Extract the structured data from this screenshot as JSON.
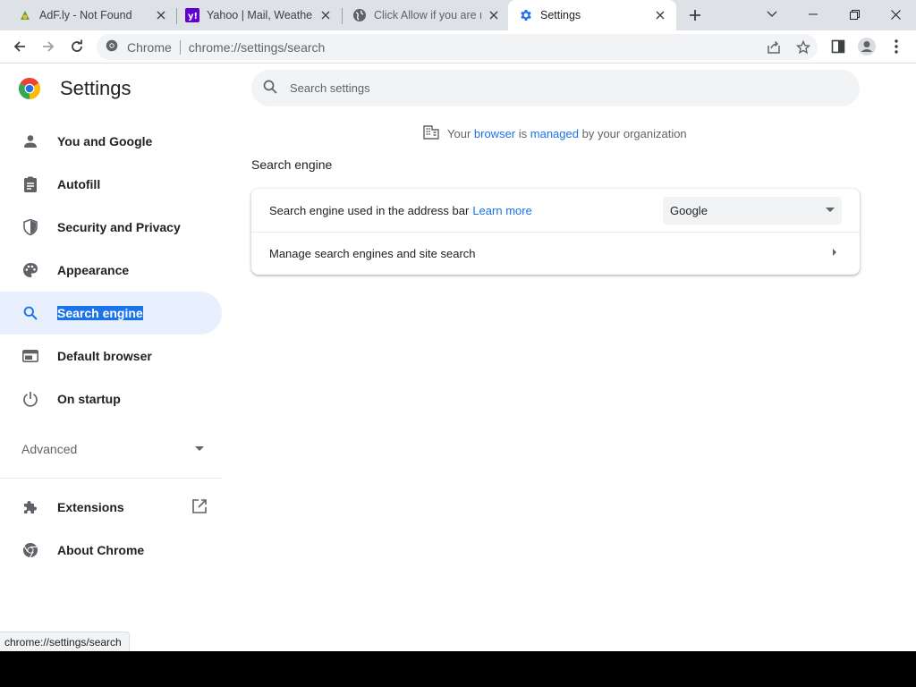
{
  "tabs": [
    {
      "title": "AdF.ly - Not Found",
      "favicon": "adfly-favicon",
      "active": false
    },
    {
      "title": "Yahoo | Mail, Weather,",
      "favicon": "yahoo-favicon",
      "active": false
    },
    {
      "title": "Click Allow if you are n",
      "favicon": "globe-favicon",
      "active": false
    },
    {
      "title": "Settings",
      "favicon": "settings-gear-favicon",
      "active": true
    }
  ],
  "omnibox": {
    "site_chip": "Chrome",
    "url_host": "chrome://",
    "url_path": "settings/search"
  },
  "settings": {
    "title": "Settings",
    "search_placeholder": "Search settings",
    "managed": {
      "prefix": "Your ",
      "link1": "browser",
      "mid": " is ",
      "link2": "managed",
      "suffix": " by your organization"
    },
    "nav": [
      {
        "label": "You and Google",
        "icon": "person-icon"
      },
      {
        "label": "Autofill",
        "icon": "clipboard-icon"
      },
      {
        "label": "Security and Privacy",
        "icon": "shield-icon"
      },
      {
        "label": "Appearance",
        "icon": "palette-icon"
      },
      {
        "label": "Search engine",
        "icon": "search-icon",
        "selected": true
      },
      {
        "label": "Default browser",
        "icon": "browser-window-icon"
      },
      {
        "label": "On startup",
        "icon": "power-icon"
      }
    ],
    "advanced_label": "Advanced",
    "extensions_label": "Extensions",
    "about_label": "About Chrome",
    "section_title": "Search engine",
    "search_engine_row": {
      "label": "Search engine used in the address bar",
      "link": "Learn more",
      "selected_value": "Google"
    },
    "manage_row": {
      "label": "Manage search engines and site search"
    }
  },
  "status_url": "chrome://settings/search",
  "colors": {
    "accent": "#1a73e8",
    "selected_bg": "#e8f0fe",
    "tabstrip": "#dee1e6"
  }
}
